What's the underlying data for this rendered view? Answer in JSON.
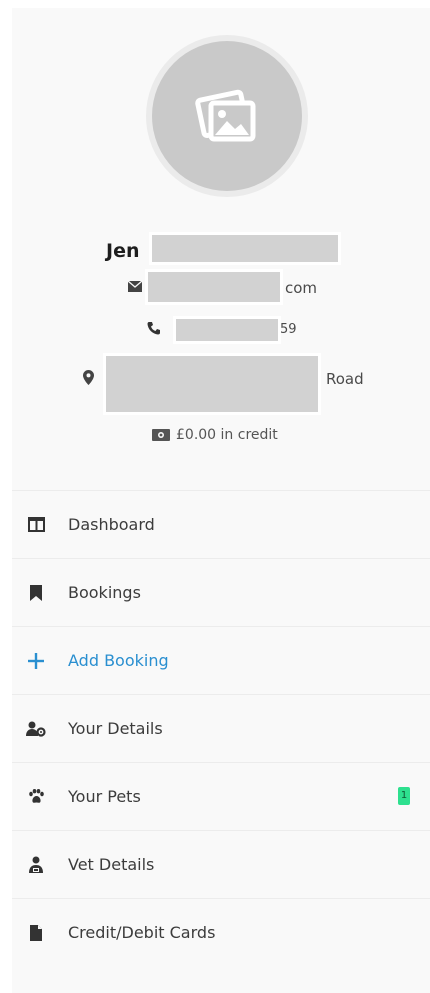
{
  "profile": {
    "name_prefix": "Jen",
    "email_suffix": "com",
    "phone_suffix": "59",
    "address_suffix": "Road",
    "credit_text": "£0.00 in credit"
  },
  "menu": {
    "items": [
      {
        "label": "Dashboard",
        "icon": "dashboard-icon"
      },
      {
        "label": "Bookings",
        "icon": "bookmark-icon"
      },
      {
        "label": "Add Booking",
        "icon": "plus-icon",
        "active": true
      },
      {
        "label": "Your Details",
        "icon": "user-cog-icon"
      },
      {
        "label": "Your Pets",
        "icon": "paw-icon",
        "badge": "1"
      },
      {
        "label": "Vet Details",
        "icon": "vet-icon"
      },
      {
        "label": "Credit/Debit Cards",
        "icon": "file-icon"
      }
    ]
  },
  "colors": {
    "accent": "#2a8fd0",
    "badge": "#2ee08f",
    "redaction": "#d2d2d2",
    "panel_bg": "#f9f9f9"
  }
}
